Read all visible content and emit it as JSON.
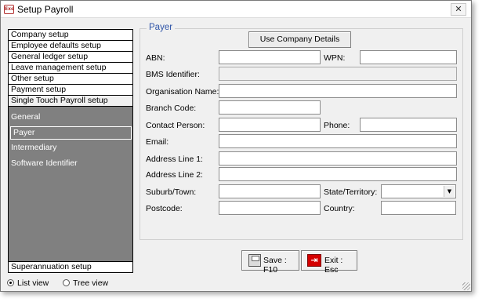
{
  "window": {
    "title": "Setup Payroll",
    "app_icon_text": "Exo",
    "close_glyph": "✕"
  },
  "sidebar": {
    "items": [
      {
        "label": "Company setup"
      },
      {
        "label": "Employee defaults setup"
      },
      {
        "label": "General ledger setup"
      },
      {
        "label": "Leave management setup"
      },
      {
        "label": "Other setup"
      },
      {
        "label": "Payment setup"
      },
      {
        "label": "Single Touch Payroll setup"
      }
    ],
    "subitems": [
      {
        "label": "General"
      },
      {
        "label": "Payer"
      },
      {
        "label": "Intermediary"
      },
      {
        "label": "Software Identifier"
      }
    ],
    "selected_subitem": "Payer",
    "bottom_item": "Superannuation setup"
  },
  "view_mode": {
    "list_label": "List view",
    "tree_label": "Tree view",
    "selected": "List view"
  },
  "payer": {
    "legend": "Payer",
    "use_company_button": "Use Company Details",
    "labels": {
      "abn": "ABN:",
      "wpn": "WPN:",
      "bms": "BMS Identifier:",
      "organisation": "Organisation Name:",
      "branch": "Branch Code:",
      "contact": "Contact Person:",
      "phone": "Phone:",
      "email": "Email:",
      "address1": "Address Line 1:",
      "address2": "Address Line 2:",
      "suburb": "Suburb/Town:",
      "state": "State/Territory:",
      "postcode": "Postcode:",
      "country": "Country:"
    },
    "values": {
      "abn": "",
      "wpn": "",
      "bms": "",
      "organisation": "",
      "branch": "",
      "contact": "",
      "phone": "",
      "email": "",
      "address1": "",
      "address2": "",
      "suburb": "",
      "state": "",
      "postcode": "",
      "country": ""
    }
  },
  "footer": {
    "save_label": "Save : F10",
    "exit_label": "Exit : Esc"
  },
  "colors": {
    "legend": "#2f55a8",
    "nav_background": "#808080",
    "exit_icon": "#d40000"
  }
}
